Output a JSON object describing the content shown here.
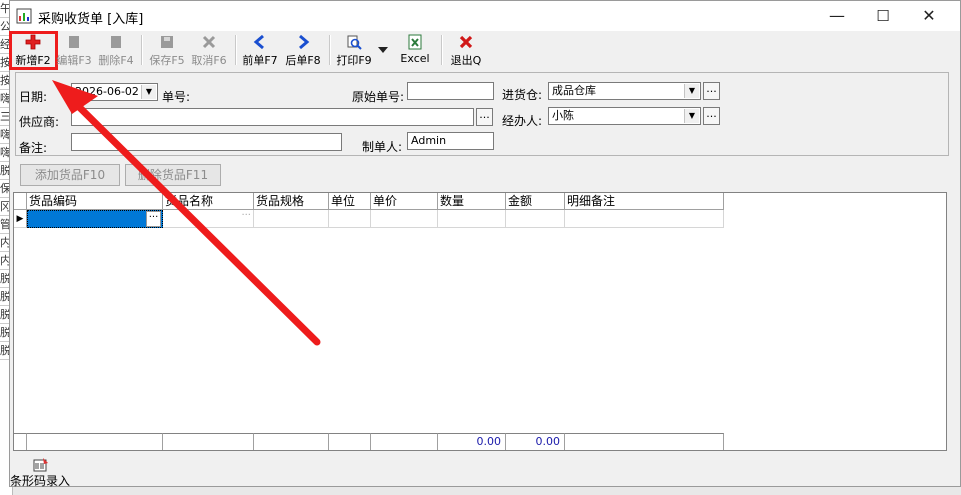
{
  "window": {
    "title": "采购收货单 [入库]",
    "minimize": "—",
    "maximize": "☐",
    "close": "✕"
  },
  "background_rows": [
    "午",
    "公",
    "经",
    "按",
    "按",
    "嗨",
    "三",
    "嗨",
    "嗨",
    "脱",
    "保",
    "冈",
    "管",
    "内",
    "内",
    "脱",
    "脱",
    "脱",
    "脱",
    "脱"
  ],
  "toolbar": {
    "new": "新增F2",
    "edit": "编辑F3",
    "delete": "删除F4",
    "save": "保存F5",
    "cancel": "取消F6",
    "prev": "前单F7",
    "next": "后单F8",
    "print": "打印F9",
    "excel": "Excel",
    "exit": "退出Q"
  },
  "form": {
    "date_label": "日期:",
    "date_value": "2026-06-02",
    "bill_no_label": "单号:",
    "orig_no_label": "原始单号:",
    "orig_no_value": "",
    "warehouse_label": "进货仓:",
    "warehouse_value": "成品仓库",
    "supplier_label": "供应商:",
    "supplier_value": "",
    "handler_label": "经办人:",
    "handler_value": "小陈",
    "remark_label": "备注:",
    "remark_value": "",
    "maker_label": "制单人:",
    "maker_value": "Admin",
    "ellipsis": "..."
  },
  "buttons": {
    "add_goods": "添加货品F10",
    "delete_goods": "删除货品F11"
  },
  "grid": {
    "columns": [
      "货品编码",
      "货品名称",
      "货品规格",
      "单位",
      "单价",
      "数量",
      "金额",
      "明细备注"
    ],
    "row_indicator": "▶",
    "cell_ellipsis": "···",
    "totals": {
      "quantity": "0.00",
      "amount": "0.00"
    }
  },
  "statusbar": {
    "barcode_entry": "条形码录入"
  },
  "colors": {
    "highlight": "#ee1c1c",
    "selection": "#0078d7",
    "totals_text": "#1a1aaa"
  }
}
